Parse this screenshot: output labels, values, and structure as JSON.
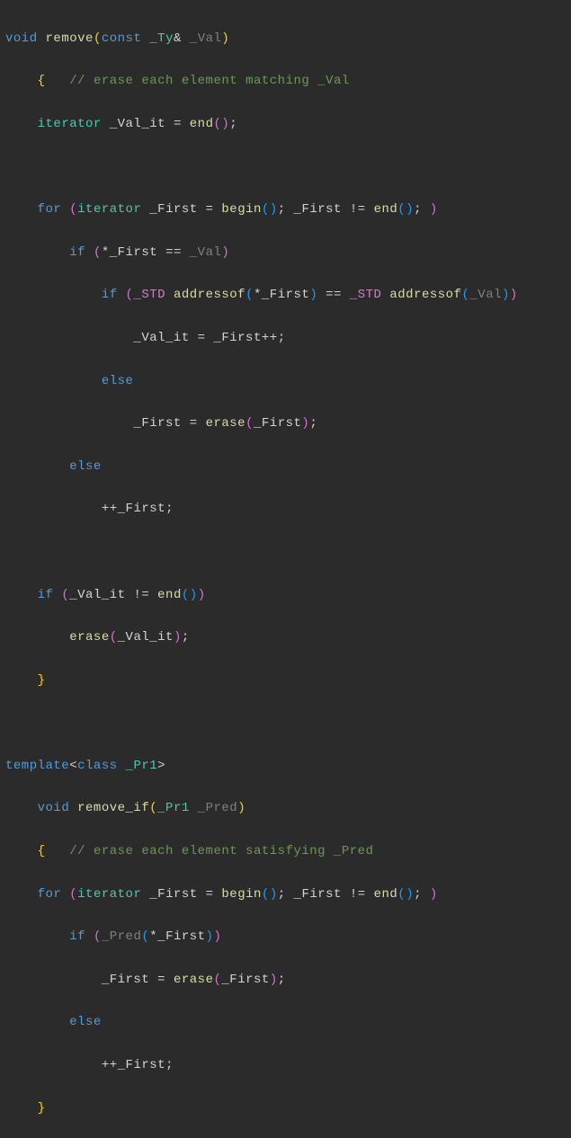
{
  "code": {
    "l1_kw_void": "void",
    "l1_fn": "remove",
    "l1_kw_const": "const",
    "l1_type_ty": "_Ty",
    "l1_amp": "&",
    "l1_param": "_Val",
    "l2_brace": "{",
    "l2_comment": "// erase each element matching _Val",
    "l3_type_iter": "iterator",
    "l3_var": "_Val_it",
    "l3_eq": " = ",
    "l3_fn_end": "end",
    "l3_semi": ";",
    "l5_kw_for": "for",
    "l5_type_iter": "iterator",
    "l5_var_first": "_First",
    "l5_eq": " = ",
    "l5_fn_begin": "begin",
    "l5_semi1": "; ",
    "l5_neq": " != ",
    "l5_fn_end": "end",
    "l5_semi2": "; ",
    "l6_kw_if": "if",
    "l6_deref": "*",
    "l6_var_first": "_First",
    "l6_eqeq": " == ",
    "l6_var_val": "_Val",
    "l7_kw_if": "if",
    "l7_macro_std1": "_STD",
    "l7_fn_addr1": "addressof",
    "l7_deref1": "*",
    "l7_var_first": "_First",
    "l7_eqeq": " == ",
    "l7_macro_std2": "_STD",
    "l7_fn_addr2": "addressof",
    "l7_var_val": "_Val",
    "l8_var_valit": "_Val_it",
    "l8_eq": " = ",
    "l8_var_first": "_First",
    "l8_pp": "++",
    "l8_semi": ";",
    "l9_kw_else": "else",
    "l10_var_first": "_First",
    "l10_eq": " = ",
    "l10_fn_erase": "erase",
    "l10_arg": "_First",
    "l10_semi": ";",
    "l11_kw_else": "else",
    "l12_pp": "++",
    "l12_var_first": "_First",
    "l12_semi": ";",
    "l14_kw_if": "if",
    "l14_var_valit": "_Val_it",
    "l14_neq": " != ",
    "l14_fn_end": "end",
    "l15_fn_erase": "erase",
    "l15_arg": "_Val_it",
    "l15_semi": ";",
    "l16_brace": "}",
    "l18_kw_template": "template",
    "l18_lt": "<",
    "l18_kw_class": "class",
    "l18_type_pr1": "_Pr1",
    "l18_gt": ">",
    "l19_kw_void": "void",
    "l19_fn": "remove_if",
    "l19_type_pr1": "_Pr1",
    "l19_param": "_Pred",
    "l20_brace": "{",
    "l20_comment": "// erase each element satisfying _Pred",
    "l21_kw_for": "for",
    "l21_type_iter": "iterator",
    "l21_var_first": "_First",
    "l21_eq": " = ",
    "l21_fn_begin": "begin",
    "l21_semi1": "; ",
    "l21_neq": " != ",
    "l21_fn_end": "end",
    "l21_semi2": "; ",
    "l22_kw_if": "if",
    "l22_fn_pred": "_Pred",
    "l22_deref": "*",
    "l22_var_first": "_First",
    "l23_var_first": "_First",
    "l23_eq": " = ",
    "l23_fn_erase": "erase",
    "l23_arg": "_First",
    "l23_semi": ";",
    "l24_kw_else": "else",
    "l25_pp": "++",
    "l25_var_first": "_First",
    "l25_semi": ";",
    "l26_brace": "}"
  }
}
